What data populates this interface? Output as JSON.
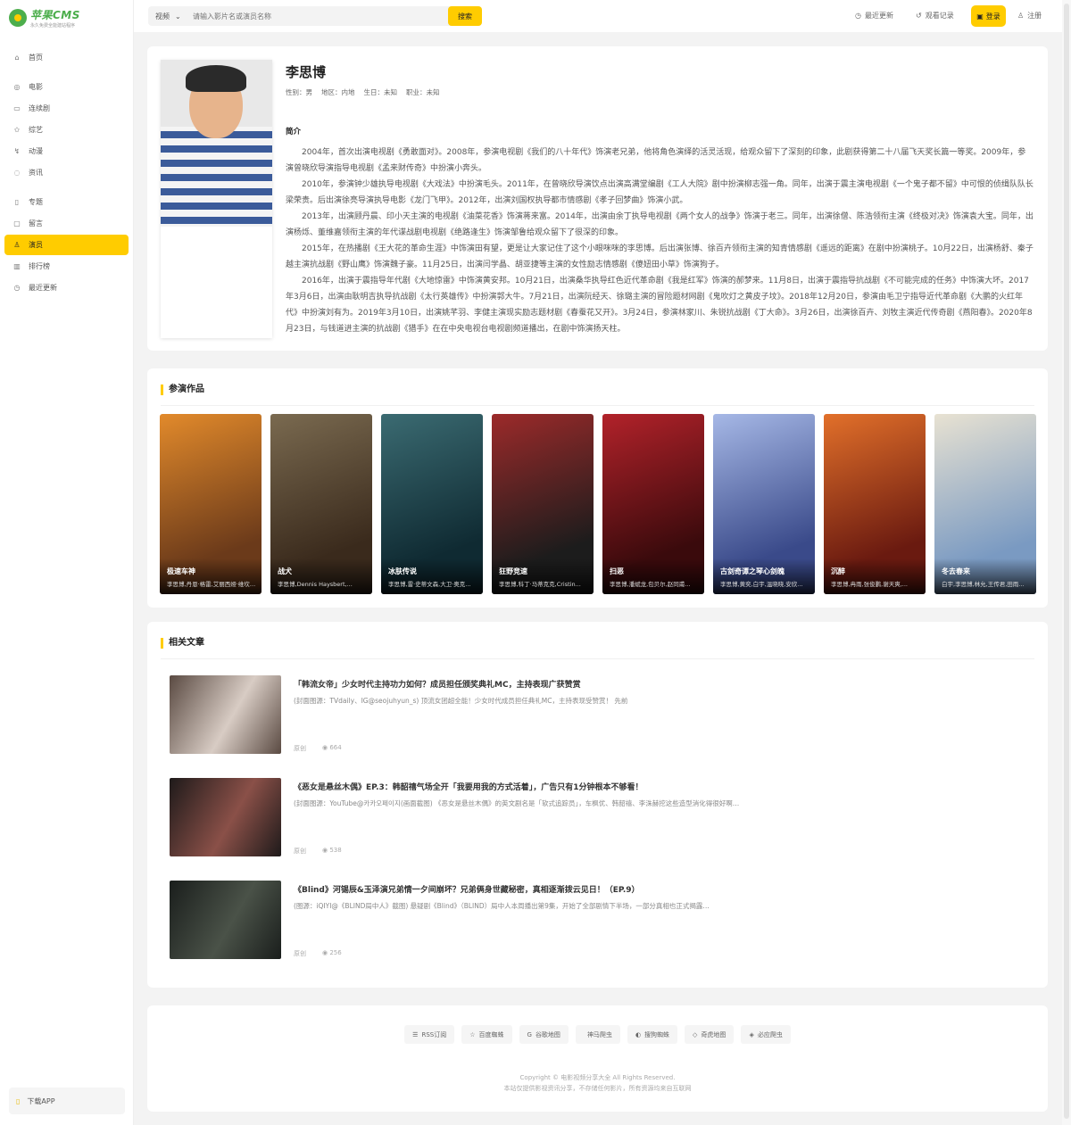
{
  "logo": {
    "title": "苹果CMS",
    "subtitle": "永久免费全能建站程序"
  },
  "sidebar": {
    "items": [
      {
        "label": "首页",
        "icon": "⌂"
      },
      {
        "label": "电影",
        "icon": "◎"
      },
      {
        "label": "连续剧",
        "icon": "▭"
      },
      {
        "label": "综艺",
        "icon": "✩"
      },
      {
        "label": "动漫",
        "icon": "↯"
      },
      {
        "label": "资讯",
        "icon": "◌"
      },
      {
        "label": "专题",
        "icon": "▯"
      },
      {
        "label": "留言",
        "icon": "▢"
      },
      {
        "label": "演员",
        "icon": "♙"
      },
      {
        "label": "排行榜",
        "icon": "▥"
      },
      {
        "label": "最近更新",
        "icon": "◷"
      }
    ],
    "active": "演员",
    "download_app": "下载APP"
  },
  "header": {
    "search_type": "视频",
    "search_placeholder": "请输入影片名或演员名称",
    "search_button": "搜索",
    "recent_updates": "最近更新",
    "watch_history": "观看记录",
    "login": "登录",
    "register": "注册"
  },
  "actor": {
    "name": "李思博",
    "gender": "性别：男",
    "region": "地区：内地",
    "birthday": "生日：未知",
    "occupation": "职业：未知",
    "intro_heading": "简介",
    "bio": [
      "2004年，首次出演电视剧《勇敢面对》。2008年，参演电视剧《我们的八十年代》饰演老兄弟，他将角色演绎的活灵活现，给观众留下了深刻的印象，此剧获得第二十八届飞天奖长篇一等奖。2009年，参演曾晓欣导演指导电视剧《孟来财传奇》中扮演小奔头。",
      "2010年，参演钟少雄执导电视剧《大戏法》中扮演毛头。2011年，在曾晓欣导演饮点出演高满堂编剧《工人大院》剧中扮演柳志强一角。同年，出演于震主演电视剧《一个鬼子都不留》中可恨的侦缉队队长梁荣贵。后出演徐亮导演执导电影《龙门飞甲》。2012年，出演刘国权执导都市情感剧《孝子回梦曲》饰演小武。",
      "2013年，出演顾丹晨、印小天主演的电视剧《油菜花香》饰演蒋来富。2014年，出演由余丁执导电视剧《两个女人的战争》饰演于老三。同年，出演徐僧、陈浩领衔主演《终极对决》饰演袁大宝。同年，出演杨烁、董维嘉领衔主演的年代谍战剧电视剧《绝路逢生》饰演邹鲁给观众留下了很深的印象。",
      "2015年，在热播剧《王大花的革命生涯》中饰演田有望，更是让大家记住了这个小眼咪咪的李思博。后出演张博、徐百卉领衔主演的知青情感剧《遥远的距离》在剧中扮演桃子。10月22日，出演杨舒、秦子越主演抗战剧《野山鹰》饰演魏子豪。11月25日，出演闫学晶、胡亚捷等主演的女性励志情感剧《傻妞田小草》饰演狗子。",
      "2016年，出演于震指导年代剧《大地惊雷》中饰演黄安邦。10月21日，出演桑华执导红色近代革命剧《我是红军》饰演的郝梦来。11月8日，出演于震指导抗战剧《不可能完成的任务》中饰演大坏。2017年3月6日，出演由耿明吉执导抗战剧《太行英雄传》中扮演郭大牛。7月21日，出演阮经天、徐璐主演的冒险题材网剧《鬼吹灯之黄皮子坟》。2018年12月20日，参演由毛卫宁指导近代革命剧《大鹏的火红年代》中扮演刘有为。2019年3月10日，出演姚芊羽、李健主演现实励志题材剧《春蚕花又开》。3月24日，参演林家川、朱锐抗战剧《丁大命》。3月26日，出演徐百卉、刘牧主演近代传奇剧《燕阳春》。2020年8月23日，与钱道进主演的抗战剧《猎手》在在中央电视台电视剧频道播出，在剧中饰演扬天柱。"
    ]
  },
  "works": {
    "title": "参演作品",
    "items": [
      {
        "title": "极速车神",
        "cast": "李思博,丹恩·格雷,艾丽西娅·维坎德,...",
        "color_a": "#6b3a1a",
        "color_b": "#e28a2b"
      },
      {
        "title": "战犬",
        "cast": "李思博,Dennis Haysbert,...",
        "color_a": "#3a2a1c",
        "color_b": "#7a6a50"
      },
      {
        "title": "冰肤传说",
        "cast": "李思博,雷·史蒂文森,大卫·奥克...",
        "color_a": "#0f2a32",
        "color_b": "#3b6b72"
      },
      {
        "title": "狂野竞速",
        "cast": "李思博,科丁·马蒂克克,Cristin...",
        "color_a": "#1c1c1c",
        "color_b": "#9c2a2a"
      },
      {
        "title": "扫恶",
        "cast": "李思博,潘斌龙,包贝尔,赵同甫...",
        "color_a": "#3a0a0c",
        "color_b": "#b2222a"
      },
      {
        "title": "古剑奇谭之琴心剑魄",
        "cast": "李思博,黄奕,白宇,温晓晓,安欣...",
        "color_a": "#3a4a8a",
        "color_b": "#a6b8e6"
      },
      {
        "title": "沉醉",
        "cast": "李思博,冉雨,张俊鹏,谢天爽,...",
        "color_a": "#6a1a10",
        "color_b": "#e2702a"
      },
      {
        "title": "冬去春来",
        "cast": "白宇,李思博,林允,王传君,田雨...",
        "color_a": "#7a9ac2",
        "color_b": "#e8e2d2"
      }
    ]
  },
  "articles": {
    "title": "相关文章",
    "items": [
      {
        "title": "「韩流女帝」少女时代主持功力如何？成员担任颁奖典礼MC，主持表现广获赞赏",
        "desc": "(封面图源：TVdaily、IG@seojuhyun_s) 顶流女团超全能！少女时代成员担任典礼MC，主持表现受赞赏！ 先前",
        "category": "原创",
        "views": "664",
        "color_a": "#5a4a42",
        "color_b": "#d8ccc4"
      },
      {
        "title": "《恶女是悬丝木偶》EP.3：韩韶禧气场全开「我要用我的方式活着」，广告只有1分钟根本不够看！",
        "desc": "(封面图源：YouTube@카카오페이지(画面截图) 《恶女是悬丝木偶》的英文剧名是「软式追踪员」，车枫优、韩韶禧、李洙赫挖这些造型消化得很好啊…",
        "category": "原创",
        "views": "538",
        "color_a": "#1e1a1a",
        "color_b": "#8a5048"
      },
      {
        "title": "《Blind》河锡辰&玉泽演兄弟情一夕间崩坏？兄弟俩身世藏秘密，真相逐渐拨云见日！（EP.9）",
        "desc": "(图源：iQIYI@《BLIND局中人》截图) 悬疑剧《Blind》（BLIND）局中人本周播出第9集，开始了全部剧情下半场，一部分真相也正式揭露…",
        "category": "原创",
        "views": "256",
        "color_a": "#1a1e1c",
        "color_b": "#4a5248"
      }
    ]
  },
  "footer": {
    "links": [
      "RSS订阅",
      "百度蜘蛛",
      "谷歌地图",
      "神马爬虫",
      "搜狗蜘蛛",
      "奇虎地图",
      "必应爬虫"
    ],
    "link_icons": [
      "☰",
      "☆",
      "G",
      "",
      "◐",
      "◇",
      "◈"
    ],
    "copyright": "Copyright © 电影视频分享大全 All Rights Reserved.",
    "disclaimer": "本站仅提供影视资讯分享，不存储任何影片，所有资源均来自互联网"
  },
  "colors": {
    "accent": "#ffcc00"
  }
}
